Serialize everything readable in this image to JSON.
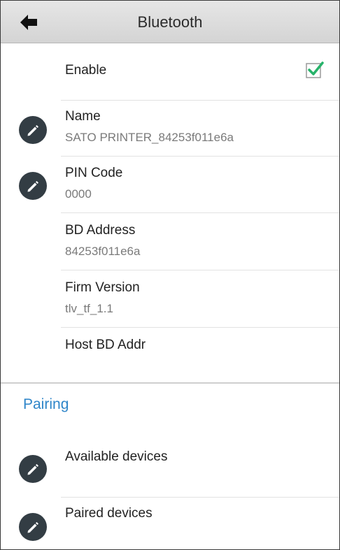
{
  "header": {
    "title": "Bluetooth",
    "back_icon": "back-arrow-icon"
  },
  "settings": {
    "enable": {
      "label": "Enable",
      "checked": true,
      "check_color": "#27b36a"
    },
    "name": {
      "label": "Name",
      "value": "SATO PRINTER_84253f011e6a"
    },
    "pin_code": {
      "label": "PIN Code",
      "value": "0000"
    },
    "bd_address": {
      "label": "BD Address",
      "value": "84253f011e6a"
    },
    "firm_version": {
      "label": "Firm Version",
      "value": "tlv_tf_1.1"
    },
    "host_bd_addr": {
      "label": "Host BD Addr",
      "value": ""
    }
  },
  "pairing": {
    "section_title": "Pairing",
    "accent_color": "#2f86c9",
    "available_devices": {
      "label": "Available devices"
    },
    "paired_devices": {
      "label": "Paired devices"
    }
  },
  "icons": {
    "edit": "pencil-icon",
    "check": "check-icon"
  }
}
